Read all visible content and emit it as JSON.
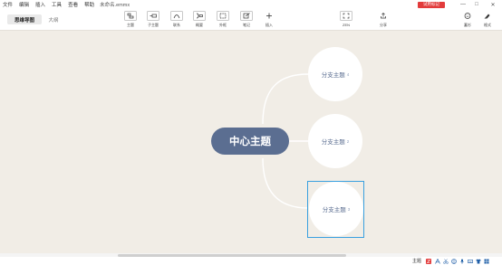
{
  "menu": {
    "items": [
      "文件",
      "编辑",
      "插入",
      "工具",
      "查看",
      "帮助"
    ],
    "filename": "未命名.emmx",
    "trial_label": "试用标记",
    "window_controls": [
      "—",
      "□",
      "✕"
    ]
  },
  "toolbar": {
    "view_tabs": [
      "思维导图",
      "大纲"
    ],
    "tools": [
      {
        "label": "主题",
        "icon": "topic-icon"
      },
      {
        "label": "子主题",
        "icon": "subtopic-icon"
      },
      {
        "label": "联系",
        "icon": "relation-icon"
      },
      {
        "label": "概要",
        "icon": "summary-icon"
      },
      {
        "label": "外框",
        "icon": "boundary-icon"
      },
      {
        "label": "笔记",
        "icon": "note-icon"
      },
      {
        "label": "插入",
        "icon": "plus-icon"
      },
      {
        "label": "ZEN",
        "icon": "zen-icon"
      },
      {
        "label": "分享",
        "icon": "share-icon"
      },
      {
        "label": "蓄杉",
        "icon": "smile-icon"
      },
      {
        "label": "格式",
        "icon": "brush-icon"
      }
    ]
  },
  "map": {
    "center": "中心主题",
    "branches": [
      {
        "label": "分支主题",
        "index": "4"
      },
      {
        "label": "分支主题",
        "index": "2"
      },
      {
        "label": "分支主题",
        "index": "3"
      }
    ],
    "link_color": "#ffffff",
    "center_color": "#5b6e91",
    "selection_color": "#39a0e0"
  },
  "status": {
    "topic_label": "主题",
    "icons": [
      "topic-count-badge",
      "font-icon",
      "scissors-icon",
      "globe-icon",
      "mic-icon",
      "keyboard-icon",
      "tshirt-icon",
      "grid-icon"
    ]
  }
}
